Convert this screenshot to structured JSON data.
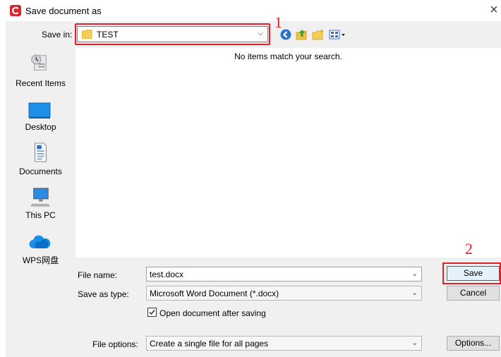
{
  "window": {
    "title": "Save document as",
    "close_glyph": "×"
  },
  "save_in": {
    "label": "Save in:",
    "value": "TEST",
    "annotation": "1"
  },
  "toolbar": {
    "icons": [
      "back-icon",
      "up-folder-icon",
      "new-folder-icon",
      "view-menu-icon"
    ]
  },
  "places": [
    {
      "label": "Recent Items",
      "icon": "recent-items-icon"
    },
    {
      "label": "Desktop",
      "icon": "desktop-icon"
    },
    {
      "label": "Documents",
      "icon": "documents-icon"
    },
    {
      "label": "This PC",
      "icon": "this-pc-icon"
    },
    {
      "label": "WPS网盘",
      "icon": "cloud-icon"
    }
  ],
  "file_list": {
    "empty_message": "No items match your search."
  },
  "file_name": {
    "label": "File name:",
    "value": "test.docx"
  },
  "save_as_type": {
    "label": "Save as type:",
    "value": "Microsoft Word Document (*.docx)"
  },
  "open_after": {
    "label": "Open document after saving",
    "checked": true
  },
  "file_options": {
    "label": "File options:",
    "value": "Create a single file for all pages"
  },
  "buttons": {
    "save": "Save",
    "cancel": "Cancel",
    "options": "Options..."
  },
  "annotation_2": "2",
  "colors": {
    "annotation_red": "#e0202a",
    "dialog_bg": "#f0f0f0",
    "accent": "#0078d7"
  }
}
